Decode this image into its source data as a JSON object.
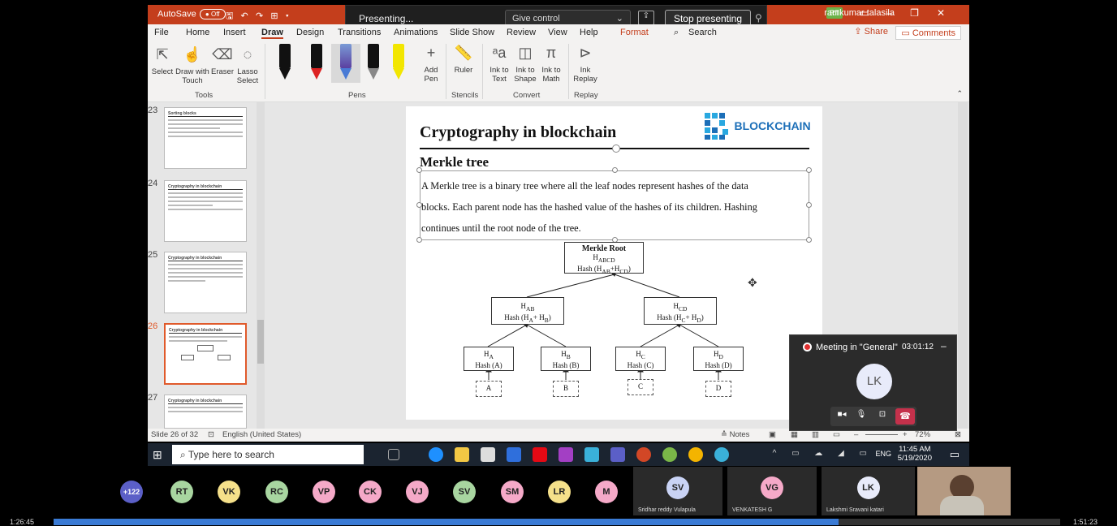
{
  "titlebar": {
    "autosave_label": "AutoSave",
    "autosave_state": "Off",
    "user_name": "ramkumar talasila",
    "user_initials": "RT"
  },
  "presenting": {
    "label": "Presenting...",
    "give_control": "Give control",
    "stop_presenting": "Stop presenting"
  },
  "menu": {
    "items": [
      "File",
      "Home",
      "Insert",
      "Draw",
      "Design",
      "Transitions",
      "Animations",
      "Slide Show",
      "Review",
      "View",
      "Help",
      "Format",
      "Search"
    ],
    "share": "Share",
    "comments": "Comments"
  },
  "ribbon": {
    "tools": [
      "Select",
      "Draw with Touch",
      "Eraser",
      "Lasso Select"
    ],
    "tools_group": "Tools",
    "pens_group": "Pens",
    "add_pen": "Add Pen",
    "ruler": "Ruler",
    "stencils_group": "Stencils",
    "ink_to_text": "Ink to Text",
    "ink_to_shape": "Ink to Shape",
    "ink_to_math": "Ink to Math",
    "convert_group": "Convert",
    "ink_replay": "Ink Replay",
    "replay_group": "Replay"
  },
  "thumbnails": [
    {
      "num": "23",
      "title": "Sorting blocks"
    },
    {
      "num": "24",
      "title": "Cryptography in blockchain"
    },
    {
      "num": "25",
      "title": "Cryptography in blockchain"
    },
    {
      "num": "26",
      "title": "Cryptography in blockchain"
    },
    {
      "num": "27",
      "title": "Cryptography in blockchain"
    }
  ],
  "slide": {
    "title": "Cryptography in blockchain",
    "logo_text": "BLOCKCHAIN",
    "subtitle": "Merkle tree",
    "body_line1": "A Merkle tree is a binary tree where all the leaf nodes represent hashes of the data",
    "body_line2": "blocks. Each parent node has the hashed value of the hashes of its children. Hashing",
    "body_line3": "continues until the root node of the tree.",
    "root": {
      "title": "Merkle Root",
      "h": "H",
      "hsub": "ABCD",
      "hash": "Hash (H",
      "hash_sub1": "AB",
      "hash_mid": "+H",
      "hash_sub2": "CD",
      "hash_end": ")"
    },
    "mid_left": {
      "h": "H",
      "hsub": "AB",
      "hash": "Hash (H",
      "s1": "A",
      "mid": "+ H",
      "s2": "B",
      "end": ")"
    },
    "mid_right": {
      "h": "H",
      "hsub": "CD",
      "hash": "Hash (H",
      "s1": "C",
      "mid": "+ H",
      "s2": "D",
      "end": ")"
    },
    "leaves": [
      {
        "h": "H",
        "sub": "A",
        "hash": "Hash (A)",
        "data": "A"
      },
      {
        "h": "H",
        "sub": "B",
        "hash": "Hash (B)",
        "data": "B"
      },
      {
        "h": "H",
        "sub": "C",
        "hash": "Hash (C)",
        "data": "C"
      },
      {
        "h": "H",
        "sub": "D",
        "hash": "Hash (D)",
        "data": "D"
      }
    ]
  },
  "status": {
    "slide_info": "Slide 26 of 32",
    "language": "English (United States)",
    "notes": "Notes",
    "zoom": "72%"
  },
  "taskbar": {
    "search_placeholder": "Type here to search",
    "lang": "ENG",
    "time": "11:45 AM",
    "date": "5/19/2020"
  },
  "meeting": {
    "title": "Meeting in \"General\"",
    "duration": "03:01:12",
    "initials": "LK"
  },
  "participants": {
    "overflow": "+122",
    "avatars": [
      {
        "initials": "RT",
        "color": "#a8d5a0"
      },
      {
        "initials": "VK",
        "color": "#f5e08a"
      },
      {
        "initials": "RC",
        "color": "#a8d5a0"
      },
      {
        "initials": "VP",
        "color": "#f5a9c8"
      },
      {
        "initials": "CK",
        "color": "#f5a9c8"
      },
      {
        "initials": "VJ",
        "color": "#f5a9c8"
      },
      {
        "initials": "SV",
        "color": "#a8d5a0"
      },
      {
        "initials": "SM",
        "color": "#f5a9c8"
      },
      {
        "initials": "LR",
        "color": "#f5e08a"
      },
      {
        "initials": "M",
        "color": "#f5a9c8"
      }
    ],
    "tiles": [
      {
        "initials": "SV",
        "name": "Sridhar reddy Vulapula",
        "color": "#c9d3f5"
      },
      {
        "initials": "VG",
        "name": "VENKATESH G",
        "color": "#f5a9c8"
      },
      {
        "initials": "LK",
        "name": "Lakshmi Sravani katari",
        "color": "#e8ebfa"
      }
    ]
  },
  "playback": {
    "current": "1:26:45",
    "total": "1:51:23",
    "progress": 0.78
  }
}
